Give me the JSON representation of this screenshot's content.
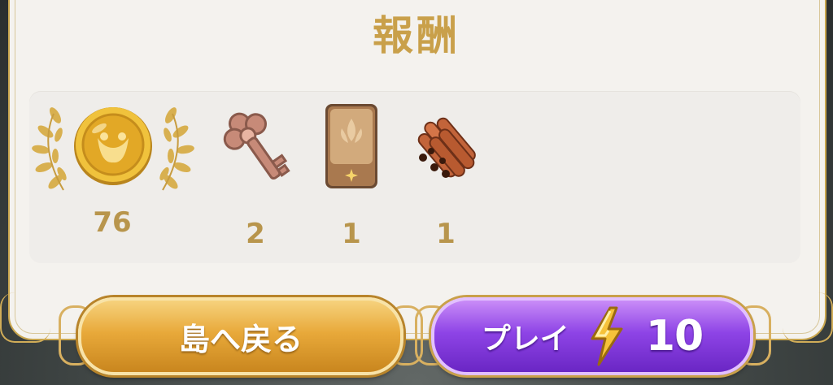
{
  "title": "報酬",
  "rewards": [
    {
      "icon": "gold-coin-laurel-icon",
      "count": "76"
    },
    {
      "icon": "bronze-key-icon",
      "count": "2"
    },
    {
      "icon": "card-pack-icon",
      "count": "1"
    },
    {
      "icon": "copper-pipes-icon",
      "count": "1"
    }
  ],
  "buttons": {
    "back_label": "島へ戻る",
    "play_label": "プレイ",
    "play_cost": "10"
  },
  "colors": {
    "accent_gold": "#c9a04a",
    "play_purple": "#8e44e6",
    "back_orange": "#e8a93a"
  }
}
